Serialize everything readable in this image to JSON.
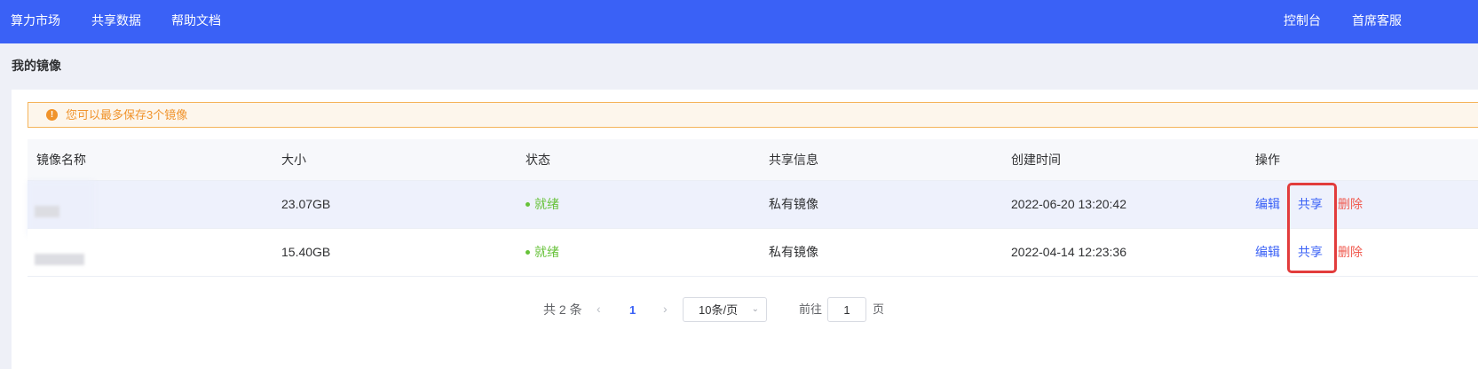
{
  "nav": {
    "left": [
      "算力市场",
      "共享数据",
      "帮助文档"
    ],
    "console": "控制台",
    "support": "首席客服"
  },
  "page_title": "我的镜像",
  "alert": {
    "icon": "warning-icon",
    "text": "您可以最多保存3个镜像"
  },
  "table": {
    "headers": [
      "镜像名称",
      "大小",
      "状态",
      "共享信息",
      "创建时间",
      "操作"
    ],
    "rows": [
      {
        "size": "23.07GB",
        "status": "就绪",
        "share": "私有镜像",
        "created": "2022-06-20 13:20:42"
      },
      {
        "size": "15.40GB",
        "status": "就绪",
        "share": "私有镜像",
        "created": "2022-04-14 12:23:36"
      }
    ],
    "actions": {
      "edit": "编辑",
      "share": "共享",
      "delete": "删除"
    }
  },
  "pagination": {
    "total": "共 2 条",
    "prev": "‹",
    "current": "1",
    "next": "›",
    "page_size": "10条/页",
    "goto_label": "前往",
    "goto_value": "1",
    "page_unit": "页"
  },
  "colors": {
    "topbar": "#3a61f6",
    "status_ready": "#67c23a",
    "link": "#3a61f6",
    "danger": "#f05a4f",
    "warning": "#f0932b",
    "highlight_frame": "#e23c3c"
  }
}
